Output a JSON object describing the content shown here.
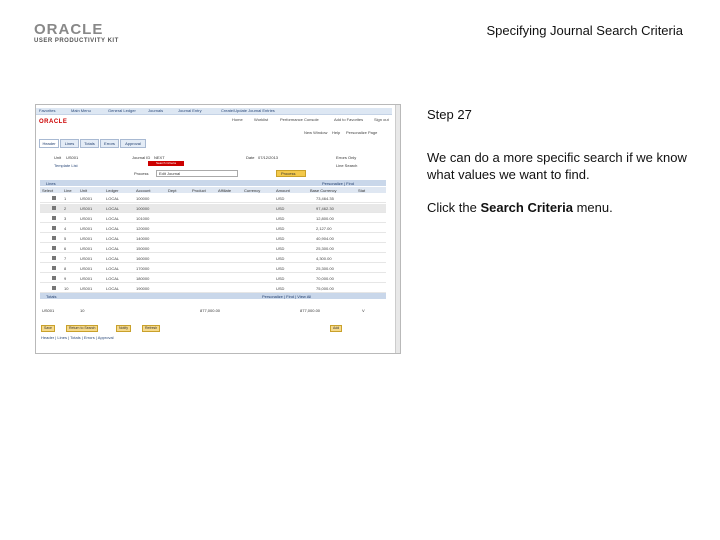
{
  "logo": {
    "word": "ORACLE",
    "sub": "USER PRODUCTIVITY KIT"
  },
  "header": {
    "title": "Specifying Journal Search Criteria"
  },
  "screenshot": {
    "navbar": [
      "Favorites",
      "Main Menu",
      "General Ledger",
      "Journals",
      "Journal Entry",
      "Create/Update Journal Entries"
    ],
    "app_logo": "ORACLE",
    "top_links": [
      "Home",
      "Worklist",
      "Performance Console",
      "Add to Favorites",
      "Sign out"
    ],
    "top_links2": [
      "New Window",
      "Help",
      "Personalize Page"
    ],
    "tabs": [
      "Header",
      "Lines",
      "Totals",
      "Errors",
      "Approval"
    ],
    "header_fields": {
      "unit_label": "Unit",
      "unit_value": "US001",
      "journal_id_label": "Journal ID",
      "journal_id_value": "NEXT",
      "date_label": "Date",
      "date_value": "07/12/2013",
      "template_label": "Template List",
      "errors_only": "Errors Only",
      "line_search": "Line Search",
      "process_label": "Process",
      "process_value": "Edit Journal",
      "process_btn": "Process",
      "red_button": "Search Criteria"
    },
    "lines": {
      "title": "Lines",
      "personalize": "Personalize | Find",
      "columns": [
        "Select",
        "Line",
        "Unit",
        "Ledger",
        "Account",
        "Dept",
        "Product",
        "Affiliate",
        "Currency",
        "Amount",
        "Base Currency",
        "Stat"
      ],
      "rows": [
        {
          "line": "1",
          "unit": "US001",
          "ledger": "LOCAL",
          "account": "100000",
          "currency": "USD",
          "amount": "73,464.35"
        },
        {
          "line": "2",
          "unit": "US001",
          "ledger": "LOCAL",
          "account": "100000",
          "currency": "USD",
          "amount": "97,462.30"
        },
        {
          "line": "3",
          "unit": "US001",
          "ledger": "LOCAL",
          "account": "101000",
          "currency": "USD",
          "amount": "12,800.00"
        },
        {
          "line": "4",
          "unit": "US001",
          "ledger": "LOCAL",
          "account": "120000",
          "currency": "USD",
          "amount": "2,127.00"
        },
        {
          "line": "5",
          "unit": "US001",
          "ledger": "LOCAL",
          "account": "140000",
          "currency": "USD",
          "amount": "40,904.00"
        },
        {
          "line": "6",
          "unit": "US001",
          "ledger": "LOCAL",
          "account": "150000",
          "currency": "USD",
          "amount": "25,300.00"
        },
        {
          "line": "7",
          "unit": "US001",
          "ledger": "LOCAL",
          "account": "160000",
          "currency": "USD",
          "amount": "4,300.00"
        },
        {
          "line": "8",
          "unit": "US001",
          "ledger": "LOCAL",
          "account": "170000",
          "currency": "USD",
          "amount": "25,300.00"
        },
        {
          "line": "9",
          "unit": "US001",
          "ledger": "LOCAL",
          "account": "180000",
          "currency": "USD",
          "amount": "70,000.00"
        },
        {
          "line": "10",
          "unit": "US001",
          "ledger": "LOCAL",
          "account": "190000",
          "currency": "USD",
          "amount": "75,000.00"
        }
      ]
    },
    "totals": {
      "title": "Totals",
      "personalize": "Personalize | Find | View All",
      "unit": "US001",
      "lines": "10",
      "debits": "877,000.00",
      "credits": "877,000.00",
      "status": "V"
    },
    "buttons": [
      "Save",
      "Return to Search",
      "Notify",
      "Refresh"
    ],
    "add_btn": "Add",
    "footer": "Header | Lines | Totals | Errors | Approval"
  },
  "step": {
    "label": "Step 27"
  },
  "description": "We can do a more specific search if we know what values we want to find.",
  "instruction": {
    "pre": "Click the ",
    "bold": "Search Criteria",
    "post": " menu."
  }
}
